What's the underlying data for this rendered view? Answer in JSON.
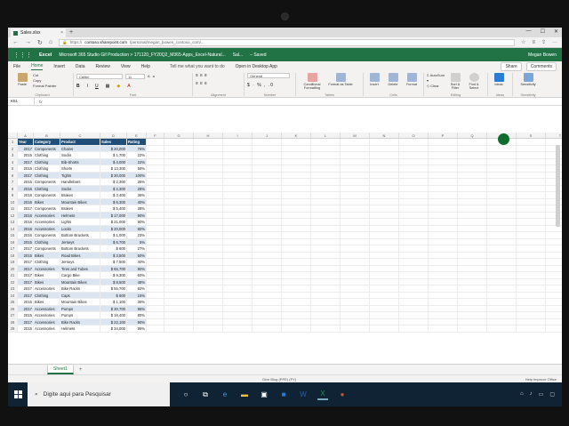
{
  "browser": {
    "tab_title": "Sales.xlsx",
    "tab_close": "×",
    "new_tab": "+",
    "window_controls": [
      "—",
      "☐",
      "✕"
    ],
    "url_prefix": "https://",
    "url_host": "contoso.sharepoint.com",
    "url_path": "/personal/megan_bowen_contoso_com/..."
  },
  "app": {
    "name": "Excel",
    "doc": "Microsoft 365 Studio Gif Production > 171120_FY20Q2_M365-Apps_Excel-Natural...",
    "short_name": "Sal...",
    "saved": "–  Saved",
    "user": "Megan Bowen"
  },
  "menu": {
    "items": [
      "File",
      "Home",
      "Insert",
      "Data",
      "Review",
      "View",
      "Help"
    ],
    "active": "Home",
    "tell_me": "Tell me what you want to do",
    "open_desktop": "Open in Desktop App",
    "share": "Share",
    "comments": "Comments"
  },
  "ribbon": {
    "paste": "Paste",
    "clipboard": [
      "Cut",
      "Copy",
      "Format Painter"
    ],
    "clipboard_label": "Clipboard",
    "font_name": "Calibri",
    "font_size": "11",
    "font_label": "Font",
    "align_label": "Alignment",
    "number_format": "General",
    "number_label": "Number",
    "cond_format": "Conditional Formatting",
    "format_table": "Format as Table",
    "styles_label": "Tables",
    "insert": "Insert",
    "delete": "Delete",
    "format": "Format",
    "cells_label": "Cells",
    "autosum": "AutoSum",
    "clear": "Clear",
    "sort_filter": "Sort & Filter",
    "find_select": "Find & Select",
    "editing_label": "Editing",
    "ideas": "Ideas",
    "ideas_label": "Ideas",
    "sensitivity": "Sensitivity",
    "sensitivity_label": "Sensitivity"
  },
  "formula_bar": {
    "name_box": "K51",
    "fx": "fx"
  },
  "grid": {
    "columns": [
      "A",
      "B",
      "C",
      "D",
      "E",
      "F",
      "G",
      "H",
      "I",
      "J",
      "K",
      "L",
      "M",
      "N",
      "O",
      "P",
      "Q",
      "R",
      "S",
      "T",
      "U"
    ],
    "headers": [
      "Year",
      "Category",
      "Product",
      "Sales",
      "Rating"
    ],
    "rows": [
      [
        "2017",
        "Components",
        "Chains",
        "$ 20,000",
        "75%"
      ],
      [
        "2015",
        "Clothing",
        "Socks",
        "$ 1,700",
        "22%"
      ],
      [
        "2017",
        "Clothing",
        "Bib-Shorts",
        "$ 4,000",
        "22%"
      ],
      [
        "2015",
        "Clothing",
        "Shorts",
        "$ 13,300",
        "56%"
      ],
      [
        "2017",
        "Clothing",
        "Tights",
        "$ 30,000",
        "100%"
      ],
      [
        "2015",
        "Components",
        "Handlebars",
        "$ 2,300",
        "35%"
      ],
      [
        "2016",
        "Clothing",
        "Socks",
        "$ 2,300",
        "28%"
      ],
      [
        "2016",
        "Components",
        "Brakes",
        "$ 3,400",
        "36%"
      ],
      [
        "2016",
        "Bikes",
        "Mountain Bikes",
        "$ 6,300",
        "40%"
      ],
      [
        "2017",
        "Components",
        "Brakes",
        "$ 5,400",
        "38%"
      ],
      [
        "2016",
        "Accessories",
        "Helmets",
        "$ 17,000",
        "90%"
      ],
      [
        "2016",
        "Accessories",
        "Lights",
        "$ 21,000",
        "90%"
      ],
      [
        "2016",
        "Accessories",
        "Locks",
        "$ 20,000",
        "90%"
      ],
      [
        "2016",
        "Components",
        "Bottom Brackets",
        "$ 1,000",
        "23%"
      ],
      [
        "2015",
        "Clothing",
        "Jerseys",
        "$ 6,700",
        "5%"
      ],
      [
        "2017",
        "Components",
        "Bottom Brackets",
        "$ 600",
        "27%"
      ],
      [
        "2015",
        "Bikes",
        "Road Bikes",
        "$ 3,500",
        "50%"
      ],
      [
        "2017",
        "Clothing",
        "Jerseys",
        "$ 7,500",
        "40%"
      ],
      [
        "2017",
        "Accessories",
        "Tires and Tubes",
        "$ 65,700",
        "90%"
      ],
      [
        "2017",
        "Bikes",
        "Cargo Bike",
        "$ 9,300",
        "60%"
      ],
      [
        "2017",
        "Bikes",
        "Mountain Bikes",
        "$ 8,500",
        "48%"
      ],
      [
        "2017",
        "Accessories",
        "Bike Racks",
        "$ 55,700",
        "92%"
      ],
      [
        "2017",
        "Clothing",
        "Caps",
        "$ 600",
        "15%"
      ],
      [
        "2015",
        "Bikes",
        "Mountain Bikes",
        "$ 1,100",
        "35%"
      ],
      [
        "2017",
        "Accessories",
        "Pumps",
        "$ 30,700",
        "95%"
      ],
      [
        "2015",
        "Accessories",
        "Pumps",
        "$ 16,400",
        "80%"
      ],
      [
        "2017",
        "Accessories",
        "Bike Racks",
        "$ 22,100",
        "90%"
      ],
      [
        "2015",
        "Accessories",
        "Helmets",
        "$ 34,000",
        "95%"
      ]
    ]
  },
  "sheet": {
    "tab": "Sheet1",
    "add": "+"
  },
  "status": {
    "left": "",
    "middle": "Give Blog (PPE) (PY)",
    "right": "Help Improve Office"
  },
  "taskbar": {
    "search_placeholder": "Digite aqui para Pesquisar"
  }
}
